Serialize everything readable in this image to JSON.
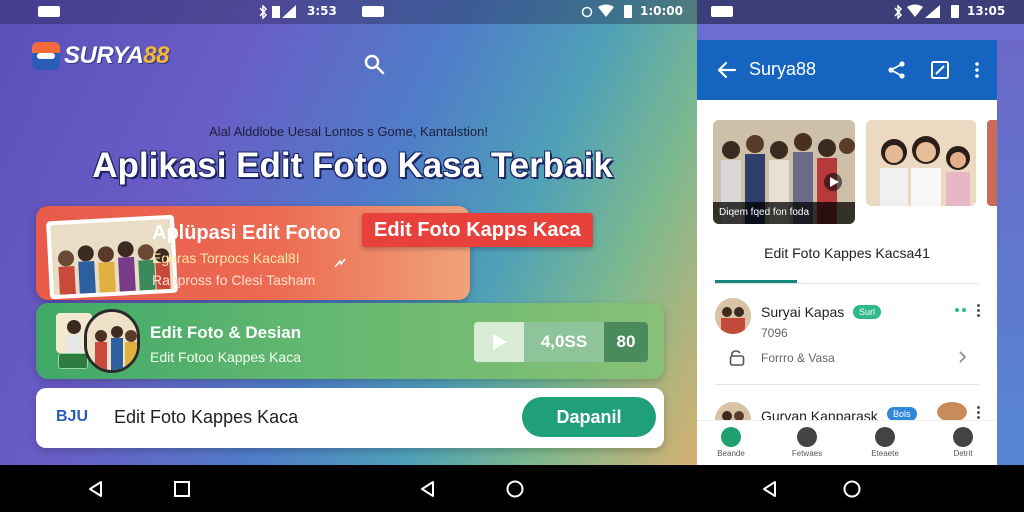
{
  "left_screen": {
    "status": {
      "time": "3:53",
      "left_icon": "sim-card-icon",
      "icons": [
        "bluetooth-icon",
        "signal-icon",
        "battery-icon"
      ]
    },
    "logo": {
      "text_main": "SURYA",
      "text_num": "88"
    },
    "search_icon": "search-icon",
    "subtitle": "Alal Alddlobe Uesal Lontos s Gome, Kantalstion!",
    "headline": "Aplikasi Edit Foto Kasa Terbaik",
    "red_card": {
      "title": "Aplüpasi Edit Fotoo",
      "line1": "Egeras Torpocs Kacal8I",
      "line2": "Rappross fo Clesi Tasham"
    },
    "red_tag": "Edit Foto Kapps Kaca",
    "green_card": {
      "title": "Edit Foto & Desian",
      "subtitle": "Edit Fotoo Kappes Kaca",
      "pill_value": "4,0SS",
      "pill_number": "80"
    },
    "white_card": {
      "badge": "BJU",
      "label": "Edit Foto Kappes Kaca",
      "button": "Dapanil"
    }
  },
  "middle_status": {
    "time": "1:0:00"
  },
  "right_screen": {
    "status": {
      "time": "13:05"
    },
    "appbar": {
      "title": "Surya88",
      "icons": [
        "back-arrow-icon",
        "share-icon",
        "edit-icon",
        "more-vert-icon"
      ]
    },
    "gallery": {
      "caption": "Diqem fqed fon foda"
    },
    "section_title": "Edit Foto Kappes Kacsa41",
    "rows": [
      {
        "name": "Suryai Kapas",
        "tag": "Surl",
        "meta": "7096",
        "sub": "Forrro & Vasa"
      },
      {
        "name": "Gurvan Kanparask",
        "tag": "Bols"
      }
    ],
    "bottom_nav": [
      {
        "label": "Beande",
        "icon": "home-icon"
      },
      {
        "label": "Fetwaes",
        "icon": "photo-icon"
      },
      {
        "label": "Eteaete",
        "icon": "location-icon"
      },
      {
        "label": "Detrit",
        "icon": "profile-icon"
      }
    ]
  },
  "colors": {
    "accent_blue": "#1565c0",
    "accent_green": "#1fa07a",
    "accent_red": "#e8413c",
    "tab_indicator": "#16857a"
  },
  "navbar": {
    "icons": [
      "back-nav-icon",
      "recents-nav-icon",
      "back-nav-icon",
      "home-nav-icon",
      "back-nav-icon",
      "home-nav-icon"
    ]
  }
}
